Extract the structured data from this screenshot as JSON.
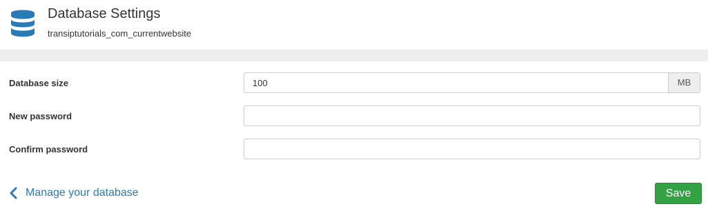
{
  "header": {
    "icon": "database-icon",
    "title": "Database Settings",
    "subtitle": "transiptutorials_com_currentwebsite"
  },
  "form": {
    "size": {
      "label": "Database size",
      "value": "100",
      "unit": "MB"
    },
    "new_password": {
      "label": "New password",
      "value": ""
    },
    "confirm_password": {
      "label": "Confirm password",
      "value": ""
    }
  },
  "footer": {
    "back_icon": "chevron-left-icon",
    "back_label": "Manage your database",
    "save_label": "Save"
  },
  "colors": {
    "accent": "#2a7ab8",
    "save_button": "#33a244",
    "band": "#eeeeee"
  }
}
